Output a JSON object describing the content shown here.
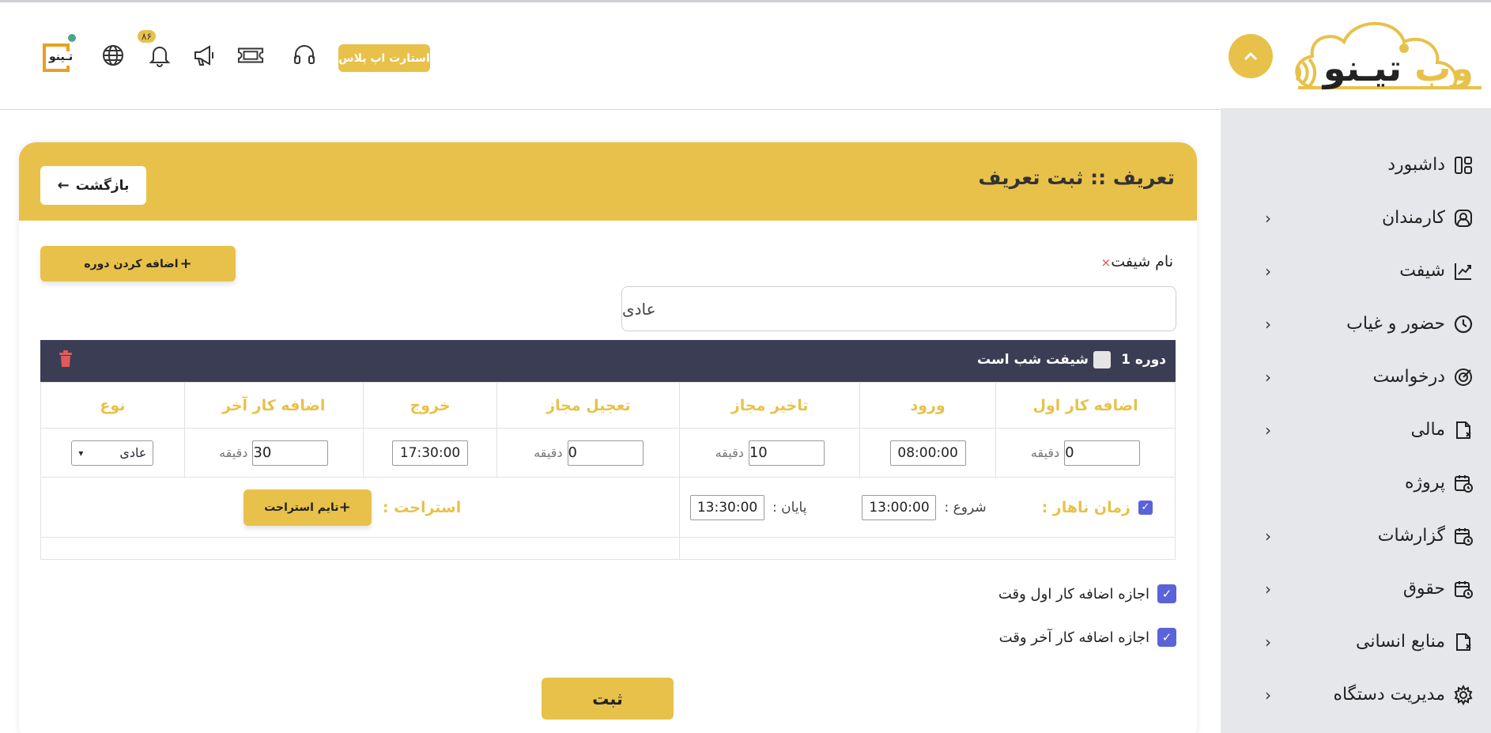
{
  "brand": {
    "logo_text_dark": "تیـنو",
    "logo_text_gold": "وب"
  },
  "sidebar": {
    "items": [
      {
        "label": "داشبورد",
        "icon": "dashboard-icon",
        "has_children": false
      },
      {
        "label": "کارمندان",
        "icon": "user-icon",
        "has_children": true
      },
      {
        "label": "شیفت",
        "icon": "chart-icon",
        "has_children": true
      },
      {
        "label": "حضور و غیاب",
        "icon": "clock-icon",
        "has_children": true
      },
      {
        "label": "درخواست",
        "icon": "target-icon",
        "has_children": true
      },
      {
        "label": "مالی",
        "icon": "file-icon",
        "has_children": true
      },
      {
        "label": "پروژه",
        "icon": "calendar-icon",
        "has_children": false
      },
      {
        "label": "گزارشات",
        "icon": "calendar-icon",
        "has_children": true
      },
      {
        "label": "حقوق",
        "icon": "calendar-icon",
        "has_children": true
      },
      {
        "label": "منابع انسانی",
        "icon": "file-icon",
        "has_children": true
      },
      {
        "label": "مدیریت دستگاه",
        "icon": "gear-icon",
        "has_children": true
      }
    ]
  },
  "header": {
    "startup_button": "استارت اپ پلاس",
    "notification_count": "۸۶",
    "avatar_text": "تـینو"
  },
  "card": {
    "title": "تعریف :: ثبت تعریف",
    "back_label": "بازگشت",
    "add_period_label": "اضافه کردن دوره",
    "shift_name_label": "نام شیفت",
    "shift_name_required": "×",
    "shift_name_value": "عادی",
    "period": {
      "title": "دوره 1",
      "night_shift_label": "شیفت شب است",
      "columns": [
        "اضافه کار اول",
        "ورود",
        "تاخیر مجاز",
        "تعجیل مجاز",
        "خروج",
        "اضافه کار آخر",
        "نوع"
      ],
      "unit": "دقیقه",
      "first_overtime": "0",
      "entry_time": "08:00:00",
      "allowed_delay": "10",
      "allowed_early": "0",
      "exit_time": "17:30:00",
      "last_overtime": "30",
      "type_value": "عادی",
      "lunch_label": "زمان ناهار :",
      "lunch_start_label": "شروع :",
      "lunch_start": "13:00:00",
      "lunch_end_label": "پایان :",
      "lunch_end": "13:30:00",
      "break_label": "استراحت :",
      "break_button": "تایم استراحت"
    },
    "options": {
      "allow_first_overtime": "اجازه اضافه کار اول وقت",
      "allow_last_overtime": "اجازه اضافه کار آخر وقت"
    },
    "submit_label": "ثبت"
  },
  "colors": {
    "accent": "#e8c14a",
    "dark_bar": "#3b3d55",
    "checkbox": "#5a63d8",
    "sidebar_bg": "#e6e7ea"
  }
}
